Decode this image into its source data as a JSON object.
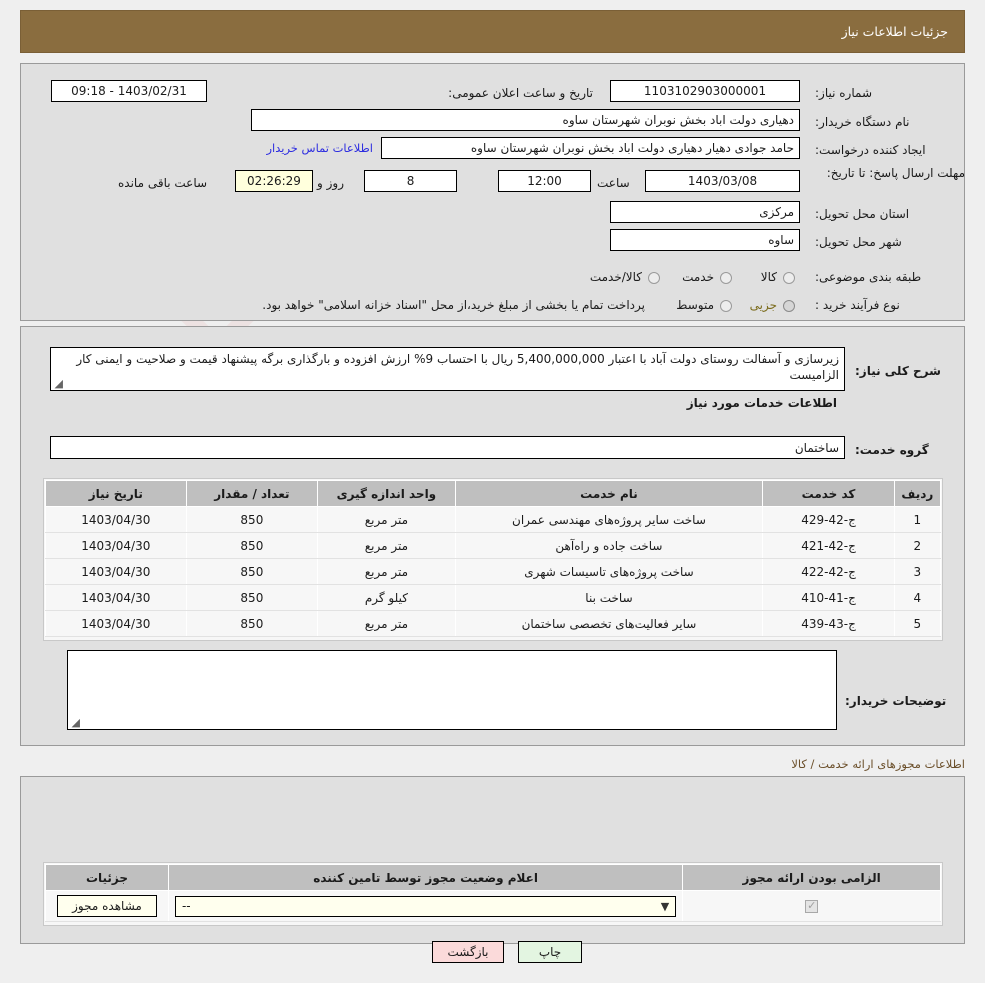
{
  "header": {
    "title": "جزئیات اطلاعات نیاز"
  },
  "form": {
    "need_number_label": "شماره نیاز:",
    "need_number_value": "1103102903000001",
    "public_announce_label": "تاریخ و ساعت اعلان عمومی:",
    "public_announce_value": "1403/02/31 - 09:18",
    "buyer_org_label": "نام دستگاه خریدار:",
    "buyer_org_value": "دهیاری دولت اباد بخش نوبران شهرستان ساوه",
    "requester_label": "ایجاد کننده درخواست:",
    "requester_value": "حامد جوادی دهیار دهیاری دولت اباد بخش نوبران شهرستان ساوه",
    "contact_link": "اطلاعات تماس خریدار",
    "deadline_label": "مهلت ارسال پاسخ: تا تاریخ:",
    "deadline_date": "1403/03/08",
    "deadline_hour_label": "ساعت",
    "deadline_hour": "12:00",
    "days_value": "8",
    "days_label": "روز و",
    "countdown": "02:26:29",
    "countdown_label": "ساعت باقی مانده",
    "province_label": "استان محل تحویل:",
    "province_value": "مرکزی",
    "city_label": "شهر محل تحویل:",
    "city_value": "ساوه",
    "category_label": "طبقه بندی موضوعی:",
    "category_options": [
      "کالا",
      "خدمت",
      "کالا/خدمت"
    ],
    "process_label": "نوع فرآیند خرید :",
    "process_options": [
      "جزیی",
      "متوسط"
    ],
    "process_selected": "جزیی",
    "process_note": "پرداخت تمام یا بخشی از مبلغ خرید،از محل \"اسناد خزانه اسلامی\" خواهد بود.",
    "summary_label": "شرح کلی نیاز:",
    "summary_value": "زیرسازی و آسفالت روستای دولت آباد با اعتبار 5,400,000,000 ریال با احتساب 9% ارزش افزوده و بارگذاری برگه پیشنهاد قیمت و صلاحیت و ایمنی کار الزامیست",
    "services_section_title": "اطلاعات خدمات مورد نیاز",
    "service_group_label": "گروه خدمت:",
    "service_group_value": "ساختمان",
    "buyer_notes_label": "توضیحات خریدار:",
    "buyer_notes_value": ""
  },
  "services_table": {
    "columns": [
      "ردیف",
      "کد خدمت",
      "نام خدمت",
      "واحد اندازه گیری",
      "تعداد / مقدار",
      "تاریخ نیاز"
    ],
    "rows": [
      [
        "1",
        "ج-42-429",
        "ساخت سایر پروژه‌های مهندسی عمران",
        "متر مربع",
        "850",
        "1403/04/30"
      ],
      [
        "2",
        "ج-42-421",
        "ساخت جاده و راه‌آهن",
        "متر مربع",
        "850",
        "1403/04/30"
      ],
      [
        "3",
        "ج-42-422",
        "ساخت پروژه‌های تاسیسات شهری",
        "متر مربع",
        "850",
        "1403/04/30"
      ],
      [
        "4",
        "ج-41-410",
        "ساخت بنا",
        "کیلو گرم",
        "850",
        "1403/04/30"
      ],
      [
        "5",
        "ج-43-439",
        "سایر فعالیت‌های تخصصی ساختمان",
        "متر مربع",
        "850",
        "1403/04/30"
      ]
    ]
  },
  "permits": {
    "section_title": "اطلاعات مجوزهای ارائه خدمت / کالا",
    "columns": [
      "الزامی بودن ارائه مجوز",
      "اعلام وضعیت مجوز توسط تامین کننده",
      "جزئیات"
    ],
    "row": {
      "required_checked": true,
      "status_value": "--",
      "details_button": "مشاهده مجوز"
    }
  },
  "footer": {
    "print_button": "چاپ",
    "back_button": "بازگشت"
  },
  "watermark": {
    "text": "AriaTender.net"
  },
  "colors": {
    "header_bar": "#8a6d3f",
    "link": "#2d2de0",
    "print_button": "#e3f5e1",
    "back_button": "#fbdada",
    "highlight": "#ffffdd"
  }
}
